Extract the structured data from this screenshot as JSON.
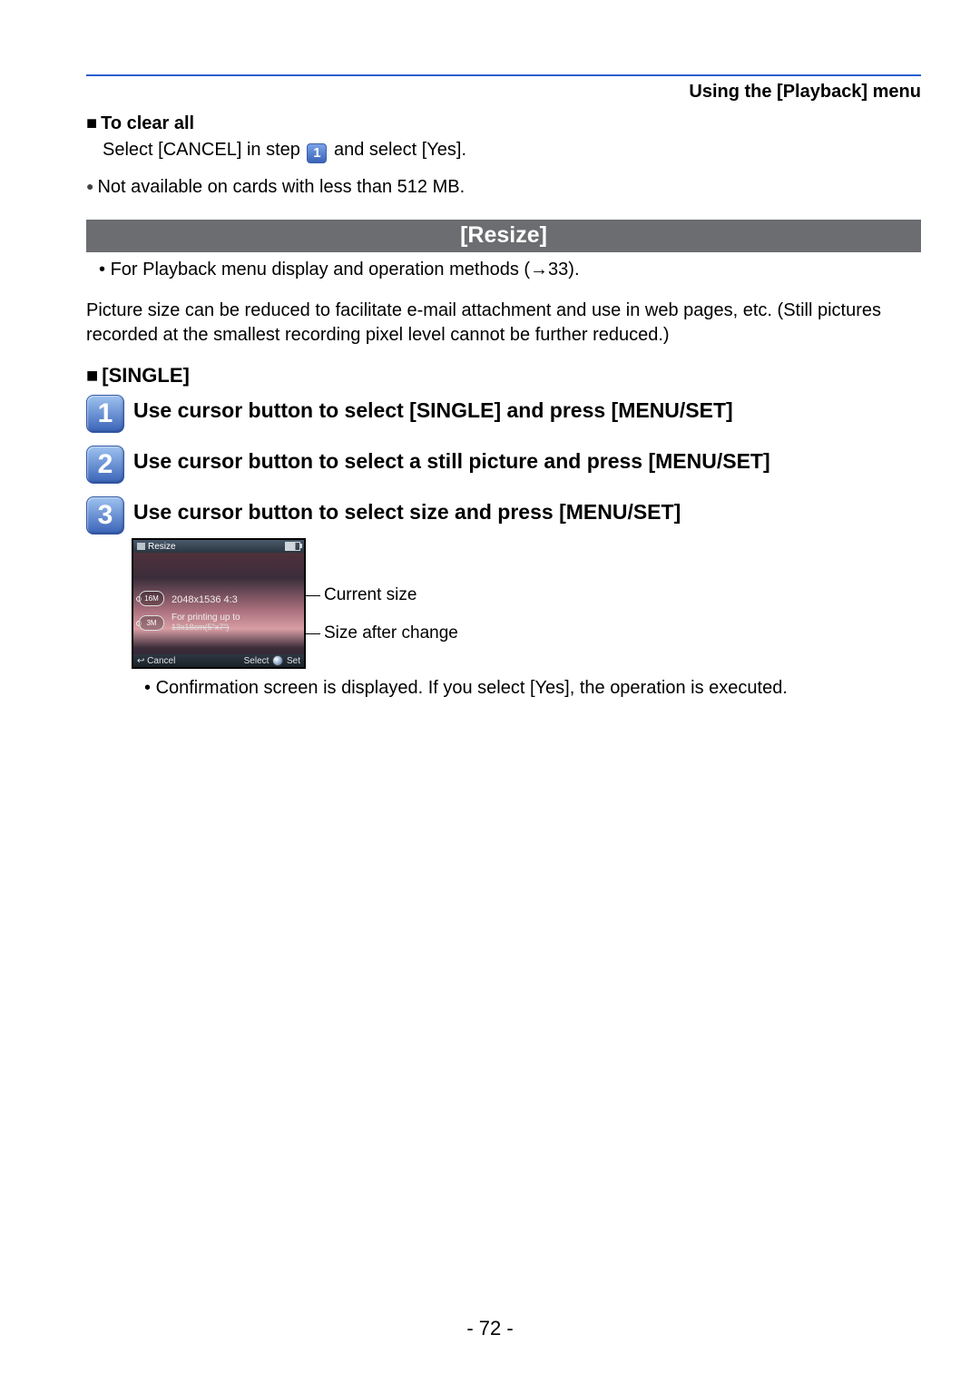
{
  "header": {
    "section_title": "Using the [Playback] menu"
  },
  "clear_all": {
    "heading": "To clear all",
    "text_before": "Select [CANCEL] in step ",
    "step_ref": "1",
    "text_after": " and select [Yes].",
    "note": "Not available on cards with less than 512 MB."
  },
  "resize": {
    "band": "[Resize]",
    "ref_line": "For Playback menu display and operation methods (→33).",
    "intro": "Picture size can be reduced to facilitate e-mail attachment and use in web pages, etc. (Still pictures recorded at the smallest recording pixel level cannot be further reduced.)",
    "sub_heading": "[SINGLE]",
    "steps": [
      {
        "n": "1",
        "text": "Use cursor button to select [SINGLE] and press [MENU/SET]"
      },
      {
        "n": "2",
        "text": "Use cursor button to select a still picture and press [MENU/SET]"
      },
      {
        "n": "3",
        "text": "Use cursor button to select size and press [MENU/SET]"
      }
    ],
    "screenshot": {
      "title": "Resize",
      "pill_a": "16M",
      "pill_b": "3M",
      "readout_size": "2048x1536 4:3",
      "readout_hint1": "For printing up to",
      "readout_hint2": "13x18cm(5\"x7\")",
      "footer_cancel": "Cancel",
      "footer_select": "Select",
      "footer_set": "Set"
    },
    "callouts": {
      "current": "Current size",
      "after": "Size after change"
    },
    "confirmation": "Confirmation screen is displayed. If you select [Yes], the operation is executed."
  },
  "page_number": "- 72 -"
}
